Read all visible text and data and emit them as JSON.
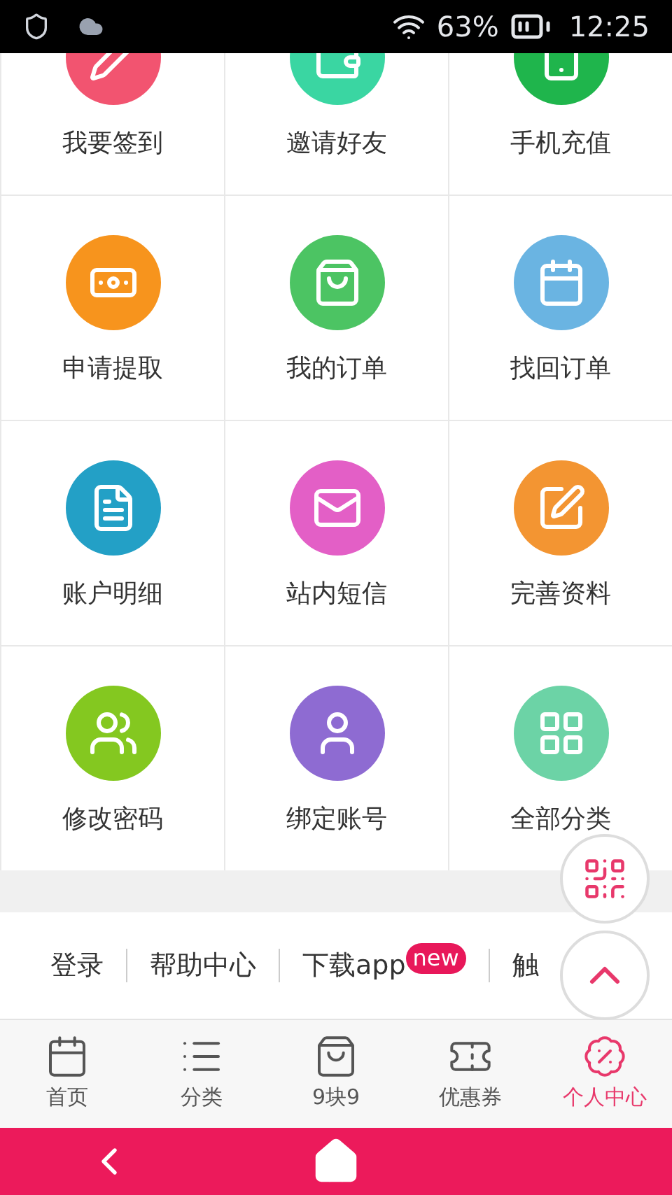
{
  "status_bar": {
    "battery": "63%",
    "time": "12:25"
  },
  "grid": [
    {
      "label": "我要签到",
      "color": "#f25470"
    },
    {
      "label": "邀请好友",
      "color": "#3ad6a2"
    },
    {
      "label": "手机充值",
      "color": "#1fb54c"
    },
    {
      "label": "申请提取",
      "color": "#f7941d"
    },
    {
      "label": "我的订单",
      "color": "#4cc463"
    },
    {
      "label": "找回订单",
      "color": "#6ab4e2"
    },
    {
      "label": "账户明细",
      "color": "#23a0c6"
    },
    {
      "label": "站内短信",
      "color": "#e35fc6"
    },
    {
      "label": "完善资料",
      "color": "#f39532"
    },
    {
      "label": "修改密码",
      "color": "#84c820"
    },
    {
      "label": "绑定账号",
      "color": "#8e6bd2"
    },
    {
      "label": "全部分类",
      "color": "#6cd3a6"
    }
  ],
  "footer_links": [
    {
      "label": "登录"
    },
    {
      "label": "帮助中心"
    },
    {
      "label": "下载app",
      "badge": "new"
    },
    {
      "label": "触"
    }
  ],
  "tabs": [
    {
      "label": "首页",
      "selected": false
    },
    {
      "label": "分类",
      "selected": false
    },
    {
      "label": "9块9",
      "selected": false
    },
    {
      "label": "优惠券",
      "selected": false
    },
    {
      "label": "个人中心",
      "selected": true
    }
  ]
}
